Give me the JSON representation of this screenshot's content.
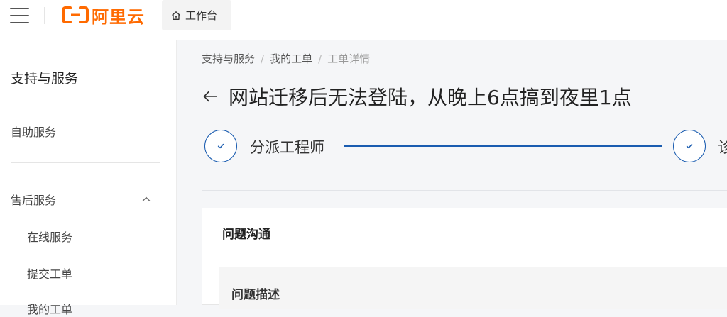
{
  "header": {
    "logo_text": "阿里云",
    "workbench_label": "工作台",
    "brand_color": "#ff6a00"
  },
  "sidebar": {
    "title": "支持与服务",
    "self_service": "自助服务",
    "after_sales": "售后服务",
    "after_sales_expanded": true,
    "sub_items": [
      {
        "label": "在线服务"
      },
      {
        "label": "提交工单"
      },
      {
        "label": "我的工单"
      }
    ]
  },
  "breadcrumb": {
    "items": [
      "支持与服务",
      "我的工单",
      "工单详情"
    ]
  },
  "page": {
    "title": "网站迁移后无法登陆，从晚上6点搞到夜里1点"
  },
  "steps": [
    {
      "label": "分派工程师",
      "status": "done"
    },
    {
      "label": "诊",
      "status": "done"
    }
  ],
  "card": {
    "title": "问题沟通",
    "subpanel_title": "问题描述"
  },
  "icons": {
    "menu": "hamburger-icon",
    "home": "home-icon",
    "back": "arrow-left-icon",
    "check": "check-icon",
    "chevron": "chevron-up-icon"
  },
  "accent_color": "#1a5cb0"
}
